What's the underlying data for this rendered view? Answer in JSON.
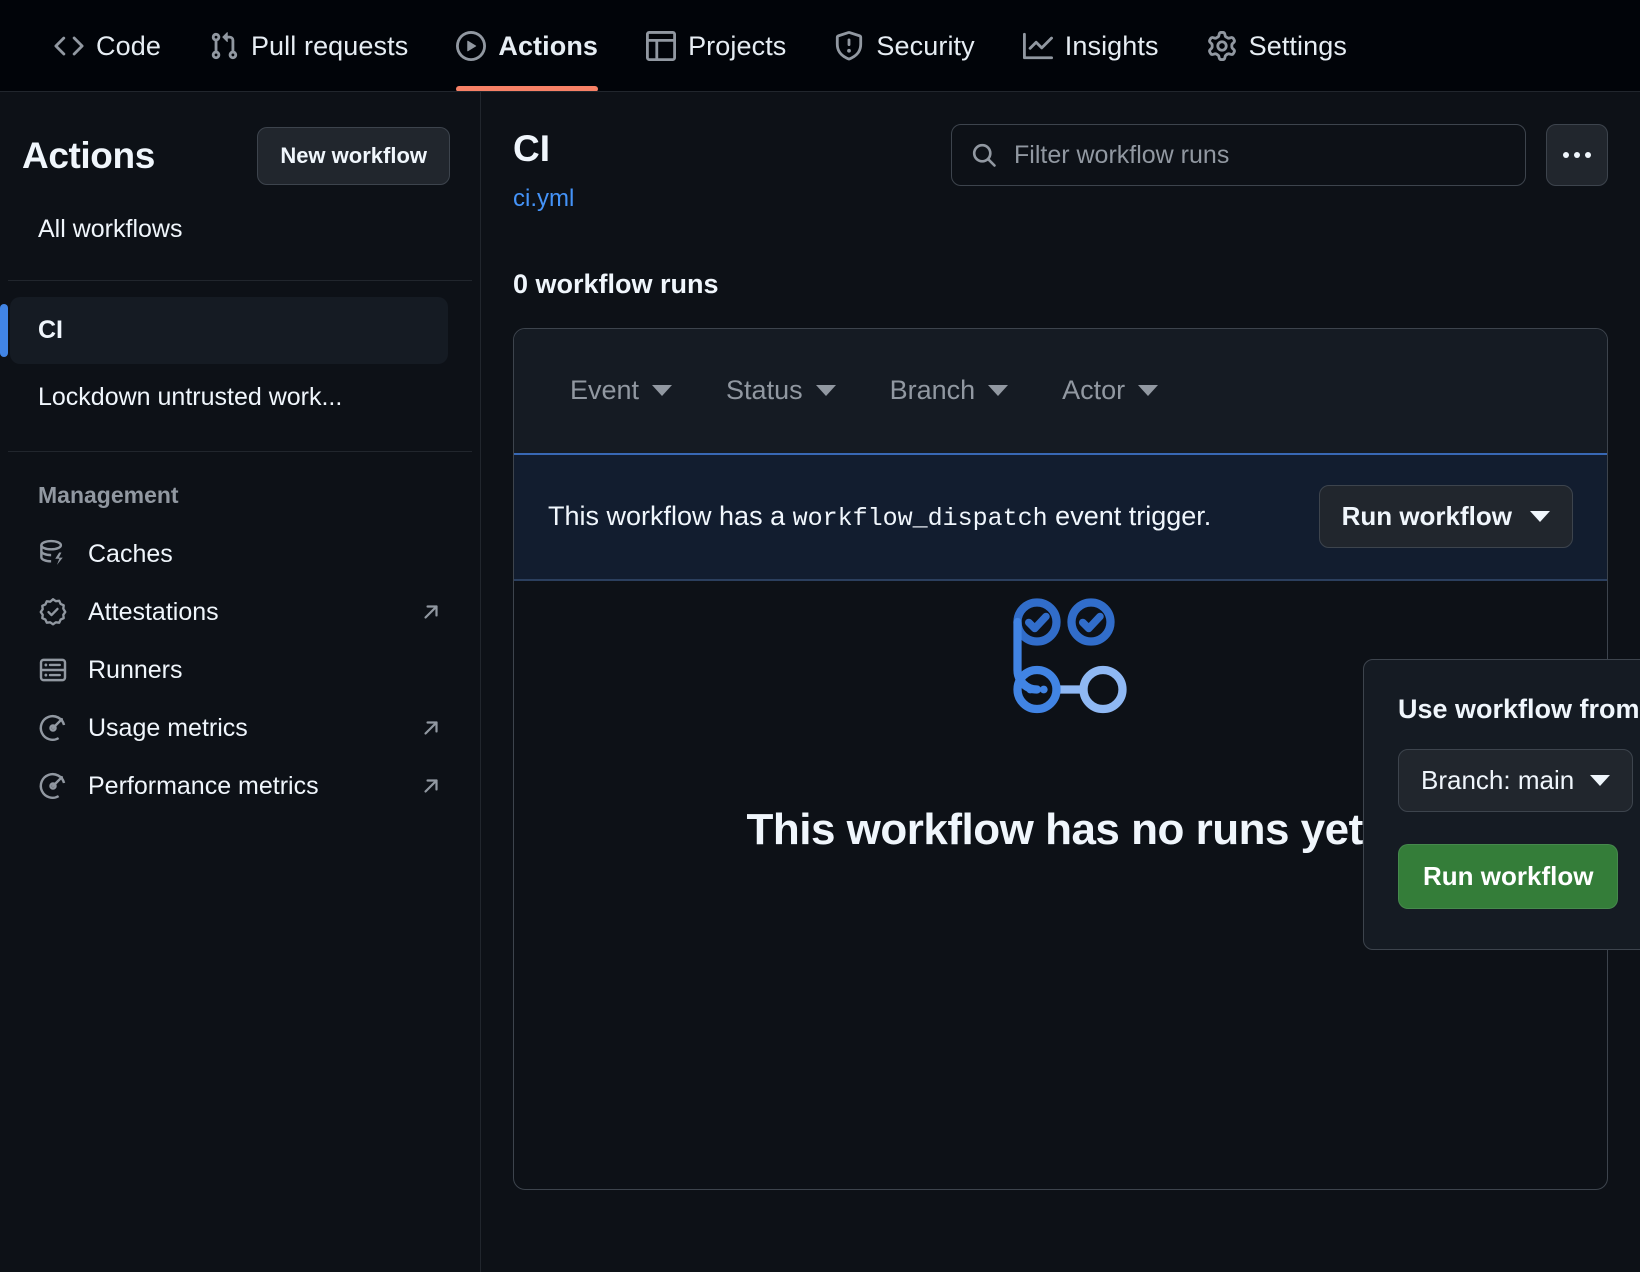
{
  "topnav": {
    "items": [
      {
        "label": "Code",
        "icon": "code-icon",
        "active": false
      },
      {
        "label": "Pull requests",
        "icon": "git-pull-request-icon",
        "active": false
      },
      {
        "label": "Actions",
        "icon": "play-circle-icon",
        "active": true
      },
      {
        "label": "Projects",
        "icon": "table-icon",
        "active": false
      },
      {
        "label": "Security",
        "icon": "shield-alert-icon",
        "active": false
      },
      {
        "label": "Insights",
        "icon": "graph-icon",
        "active": false
      },
      {
        "label": "Settings",
        "icon": "gear-icon",
        "active": false
      }
    ]
  },
  "sidebar": {
    "title": "Actions",
    "new_workflow_label": "New workflow",
    "all_workflows_label": "All workflows",
    "workflows": [
      {
        "label": "CI",
        "selected": true
      },
      {
        "label": "Lockdown untrusted work...",
        "selected": false
      }
    ],
    "management_header": "Management",
    "management_items": [
      {
        "label": "Caches",
        "icon": "cache-icon",
        "external": false
      },
      {
        "label": "Attestations",
        "icon": "verified-badge-icon",
        "external": true
      },
      {
        "label": "Runners",
        "icon": "server-icon",
        "external": false
      },
      {
        "label": "Usage metrics",
        "icon": "meter-icon",
        "external": true
      },
      {
        "label": "Performance metrics",
        "icon": "meter-icon",
        "external": true
      }
    ]
  },
  "main": {
    "workflow_title": "CI",
    "workflow_file": "ci.yml",
    "search_placeholder": "Filter workflow runs",
    "search_value": "",
    "runs_count_label": "0 workflow runs",
    "filters": [
      {
        "label": "Event"
      },
      {
        "label": "Status"
      },
      {
        "label": "Branch"
      },
      {
        "label": "Actor"
      }
    ],
    "dispatch_banner": {
      "text_before": "This workflow has a",
      "code": "workflow_dispatch",
      "text_after": "event trigger.",
      "run_button_label": "Run workflow"
    },
    "popover": {
      "title": "Use workflow from",
      "branch_label": "Branch: main",
      "run_button_label": "Run workflow"
    },
    "empty_state": {
      "title": "This workflow has no runs yet."
    }
  },
  "colors": {
    "page_bg": "#0d1117",
    "nav_bg": "#010409",
    "accent_underline": "#f78166",
    "link_blue": "#4493f8",
    "selected_indicator": "#4184e4",
    "banner_bg": "#121d2f",
    "banner_border": "#3868b5",
    "green_button": "#347d39",
    "illustration_blue": "#316dca",
    "illustration_light_blue": "#8fb8f3"
  }
}
